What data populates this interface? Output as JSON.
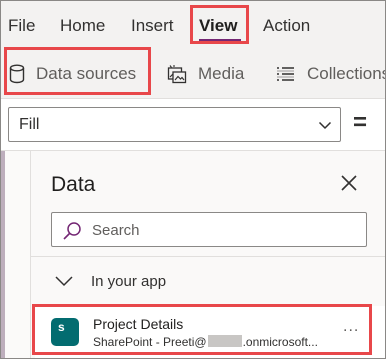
{
  "ribbon": {
    "tabs": [
      {
        "label": "File"
      },
      {
        "label": "Home"
      },
      {
        "label": "Insert"
      },
      {
        "label": "View"
      },
      {
        "label": "Action"
      }
    ]
  },
  "toolbar": {
    "data_sources_label": "Data sources",
    "media_label": "Media",
    "collections_label": "Collections"
  },
  "formula_bar": {
    "property_value": "Fill",
    "equals_sign": "="
  },
  "data_pane": {
    "title": "Data",
    "search_placeholder": "Search",
    "group_label": "In your app",
    "sources": [
      {
        "name": "Project Details",
        "subtitle_prefix": "SharePoint - Preeti@",
        "subtitle_suffix": ".onmicrosoft...",
        "logo_letter": "s",
        "more": "..."
      }
    ]
  },
  "colors": {
    "accent": "#742774",
    "highlight": "#e8474a",
    "sharepoint": "#036c70"
  },
  "icons": [
    "database-icon",
    "media-icon",
    "collections-icon",
    "chevron-down-icon",
    "close-icon",
    "search-icon",
    "sharepoint-icon"
  ]
}
